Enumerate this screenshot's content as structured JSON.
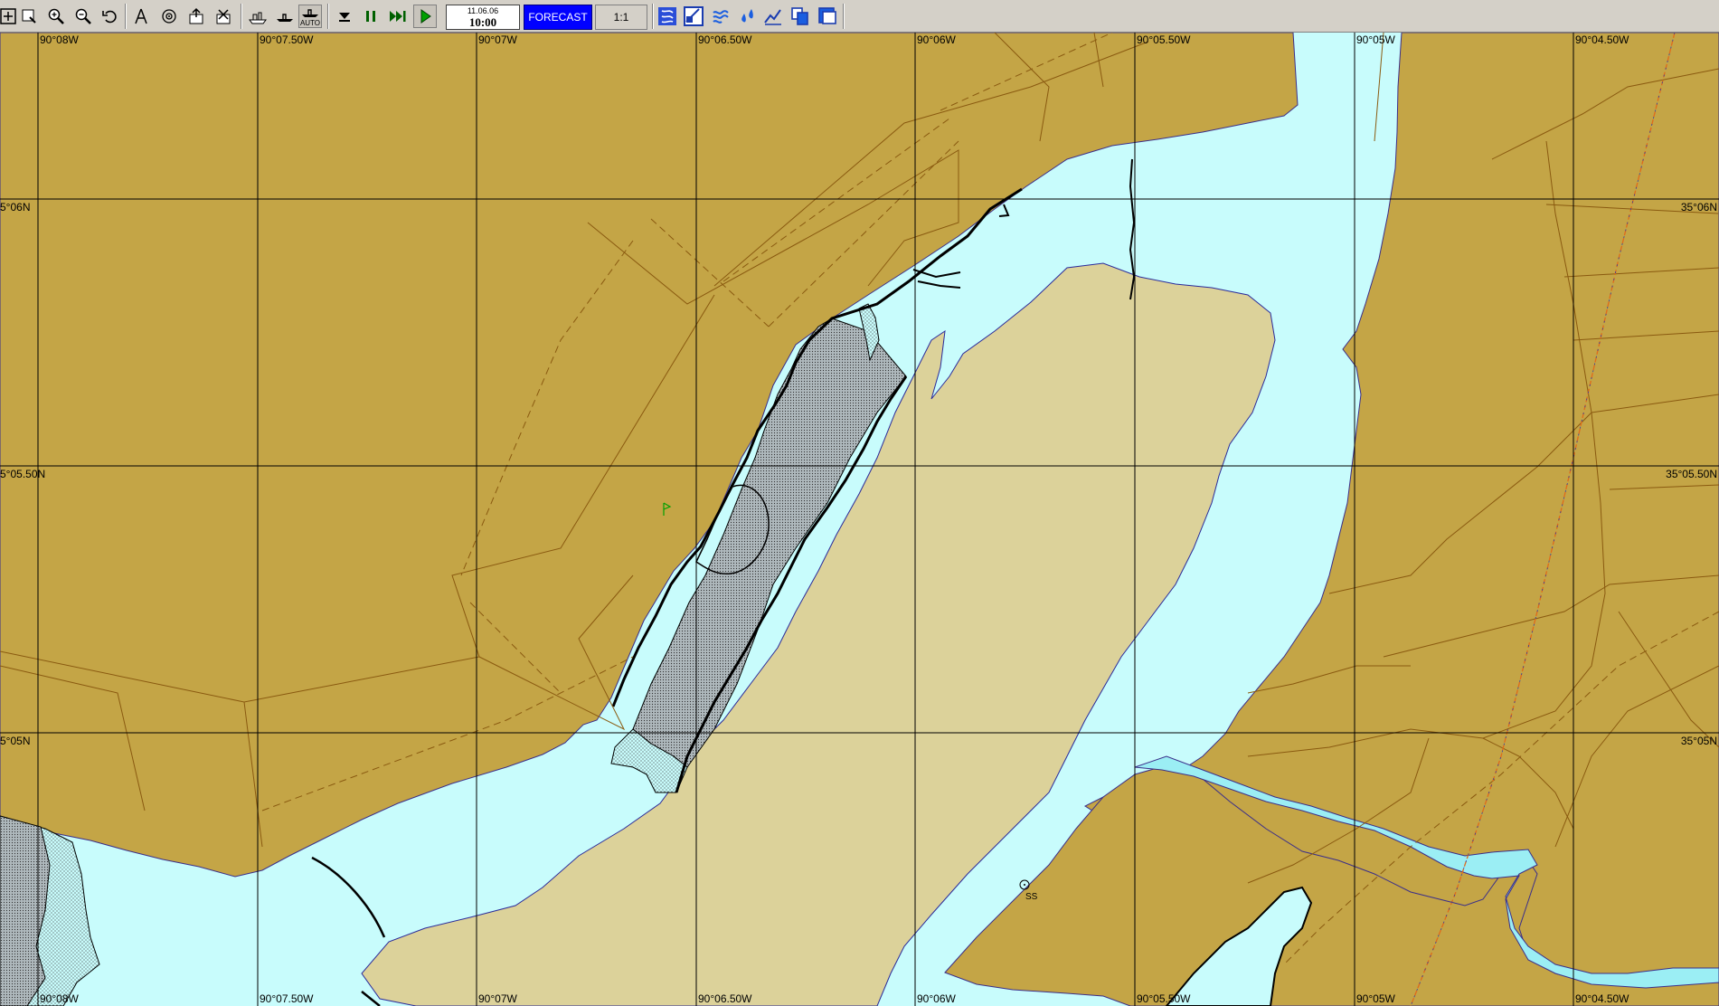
{
  "toolbar": {
    "buttons": [
      {
        "name": "zoom-window-icon"
      },
      {
        "name": "select-area-icon"
      },
      {
        "name": "zoom-in-icon"
      },
      {
        "name": "zoom-out-icon"
      },
      {
        "name": "undo-view-icon"
      },
      {
        "name": "compass-icon"
      },
      {
        "name": "target-icon"
      },
      {
        "name": "export-icon"
      },
      {
        "name": "import-icon"
      },
      {
        "name": "ship-route-icon"
      },
      {
        "name": "ship-icon"
      },
      {
        "name": "auto-ship-icon",
        "label": "AUTO"
      },
      {
        "name": "step-down-icon"
      },
      {
        "name": "pause-icon"
      },
      {
        "name": "fast-forward-icon"
      },
      {
        "name": "play-icon"
      }
    ],
    "date": "11.06.06",
    "time": "10:00",
    "forecast_label": "FORECAST",
    "scale_label": "1:1",
    "right_buttons": [
      {
        "name": "layers-icon"
      },
      {
        "name": "chart-window-icon"
      },
      {
        "name": "current-flow-icon"
      },
      {
        "name": "water-drops-icon"
      },
      {
        "name": "depth-icon"
      },
      {
        "name": "copy-windows-icon"
      },
      {
        "name": "tile-windows-icon"
      }
    ]
  },
  "map": {
    "colors": {
      "land": "#c4a546",
      "water": "#c8fcfc",
      "sandbar": "#dcd29a",
      "channel": "#9beef4",
      "grid": "#000000"
    },
    "longitude_labels": [
      "90°08W",
      "90°07.50W",
      "90°07W",
      "90°06.50W",
      "90°06W",
      "90°05.50W",
      "90°05W",
      "90°04.50W"
    ],
    "latitude_labels_left": [
      "5°06N",
      "5°05.50N",
      "5°05N"
    ],
    "latitude_labels_right": [
      "35°06N",
      "35°05.50N",
      "35°05N"
    ],
    "symbol_label": "SS"
  }
}
